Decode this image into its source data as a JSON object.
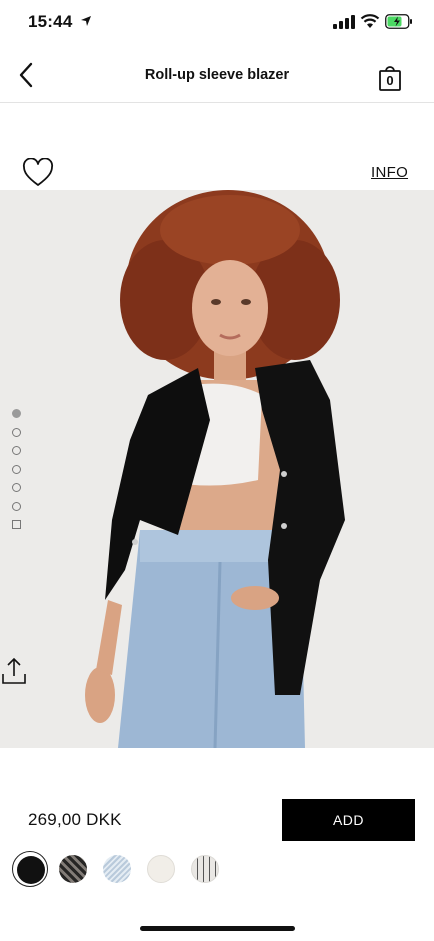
{
  "status_bar": {
    "time": "15:44",
    "icons": [
      "location-arrow-icon",
      "cellular-signal-icon",
      "wifi-icon",
      "battery-charging-icon"
    ]
  },
  "nav": {
    "back_icon": "chevron-left-icon",
    "title": "Roll-up sleeve blazer",
    "bag_icon": "shopping-bag-icon",
    "bag_count": "0"
  },
  "actions": {
    "wishlist_icon": "heart-outline-icon",
    "info_label": "INFO"
  },
  "gallery": {
    "image_subject": "model wearing black blazer, white cropped knit top and light blue jeans",
    "dot_count": 6,
    "active_index": 0,
    "has_video_indicator": true,
    "share_icon": "share-icon"
  },
  "product": {
    "price": "269,00 DKK",
    "add_label": "ADD"
  },
  "swatches": [
    {
      "name": "black",
      "color": "#111111",
      "selected": true
    },
    {
      "name": "check",
      "color": "#8f8a86",
      "selected": false
    },
    {
      "name": "light-blue-stripe",
      "color": "#c9d6e2",
      "selected": false
    },
    {
      "name": "ecru",
      "color": "#f1eee8",
      "selected": false
    },
    {
      "name": "pinstripe",
      "color": "#e9e7e4",
      "selected": false
    }
  ],
  "colors": {
    "accent": "#000000",
    "background": "#ffffff",
    "image_background": "#ecebe9"
  }
}
